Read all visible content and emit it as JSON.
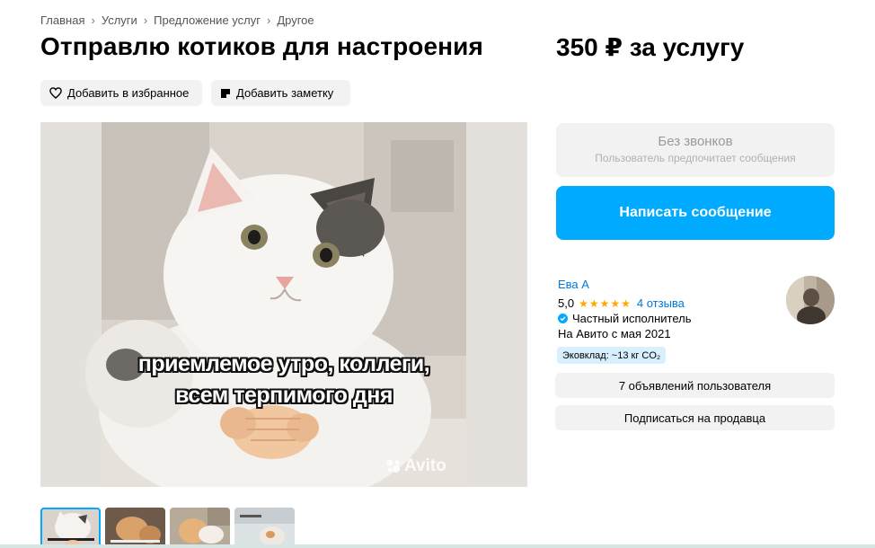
{
  "breadcrumbs": [
    "Главная",
    "Услуги",
    "Предложение услуг",
    "Другое"
  ],
  "listing": {
    "title": "Отправлю котиков для настроения",
    "price": "350 ₽ за услугу"
  },
  "actions": {
    "favorite_label": "Добавить в избранное",
    "note_label": "Добавить заметку"
  },
  "gallery": {
    "caption_line1": "приемлемое утро, коллеги,",
    "caption_line2": "всем терпимого дня",
    "watermark": "Avito",
    "thumbnail_count": 4
  },
  "contact": {
    "no_calls_title": "Без звонков",
    "no_calls_subtitle": "Пользователь предпочитает сообщения",
    "message_button": "Написать сообщение"
  },
  "seller": {
    "name": "Ева А",
    "rating": "5,0",
    "stars": 5,
    "reviews": "4 отзыва",
    "type": "Частный исполнитель",
    "since": "На Авито с мая 2021",
    "eco_badge": "Эковклад: ~13 кг CO₂",
    "ads_button": "7 объявлений пользователя",
    "subscribe_button": "Подписаться на продавца"
  },
  "colors": {
    "accent": "#00aaff",
    "link": "#0077dd",
    "star": "#ffa800",
    "chip_bg": "#f2f2f2",
    "eco_bg": "#d8f0fd"
  }
}
